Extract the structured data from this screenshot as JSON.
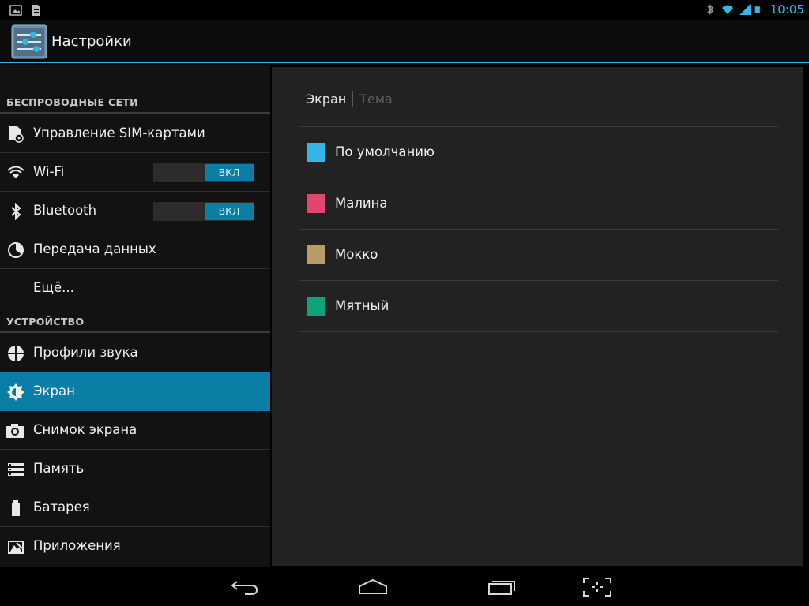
{
  "status_bar": {
    "time": "10:05",
    "left_icons": [
      "picture-icon",
      "file-icon"
    ],
    "right_icons": [
      "bluetooth-icon",
      "wifi-icon",
      "signal-icon",
      "battery-icon"
    ]
  },
  "action_bar": {
    "title": "Настройки",
    "icon": "settings-sliders-icon"
  },
  "sidebar": {
    "sections": [
      {
        "header": "БЕСПРОВОДНЫЕ СЕТИ",
        "items": [
          {
            "label": "Управление SIM-картами",
            "icon": "sim-settings-icon"
          },
          {
            "label": "Wi-Fi",
            "icon": "wifi-icon",
            "toggle": "ВКЛ"
          },
          {
            "label": "Bluetooth",
            "icon": "bluetooth-icon",
            "toggle": "ВКЛ"
          },
          {
            "label": "Передача данных",
            "icon": "data-usage-icon"
          },
          {
            "label": "Ещё...",
            "icon": ""
          }
        ]
      },
      {
        "header": "УСТРОЙСТВО",
        "items": [
          {
            "label": "Профили звука",
            "icon": "sound-profile-icon"
          },
          {
            "label": "Экран",
            "icon": "brightness-icon",
            "selected": true
          },
          {
            "label": "Снимок экрана",
            "icon": "camera-icon"
          },
          {
            "label": "Память",
            "icon": "storage-icon"
          },
          {
            "label": "Батарея",
            "icon": "battery-icon"
          },
          {
            "label": "Приложения",
            "icon": "apps-icon"
          }
        ]
      }
    ]
  },
  "content": {
    "breadcrumb_main": "Экран",
    "breadcrumb_sub": "Тема",
    "themes": [
      {
        "name": "По умолчанию",
        "color": "#33b5e5"
      },
      {
        "name": "Малина",
        "color": "#e2466e"
      },
      {
        "name": "Мокко",
        "color": "#b89b66"
      },
      {
        "name": "Мятный",
        "color": "#12a27a"
      }
    ]
  },
  "nav_bar": {
    "buttons": [
      "back-icon",
      "home-icon",
      "recent-apps-icon",
      "screenshot-icon"
    ]
  },
  "colors": {
    "accent": "#33b5e5",
    "selected_item": "#0a7ea4"
  }
}
